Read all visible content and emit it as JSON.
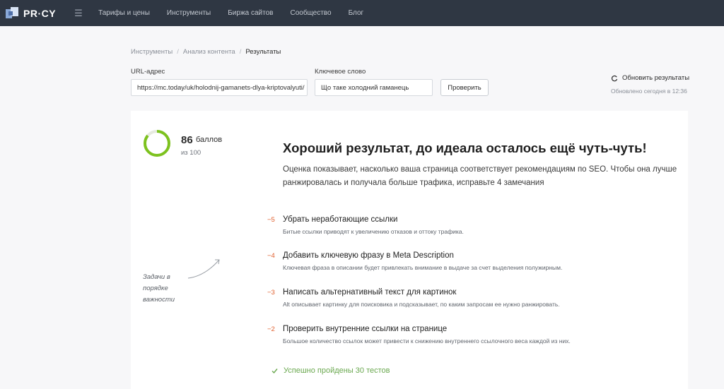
{
  "nav": {
    "logo": "PR·CY",
    "items": [
      "Тарифы и цены",
      "Инструменты",
      "Биржа сайтов",
      "Сообщество",
      "Блог"
    ]
  },
  "breadcrumb": [
    "Инструменты",
    "Анализ контента",
    "Результаты"
  ],
  "form": {
    "url_label": "URL-адрес",
    "url_value": "https://mc.today/uk/holodnij-gamanets-dlya-kriptovalyuti/",
    "keyword_label": "Ключевое слово",
    "keyword_value": "Що таке холодний гаманець",
    "check_button": "Проверить",
    "refresh_label": "Обновить результаты",
    "updated_text": "Обновлено сегодня в 12:36"
  },
  "score": {
    "value": "86",
    "unit": "баллов",
    "of": "из 100",
    "fraction": 0.86,
    "color": "#7dc21e"
  },
  "headline": "Хороший результат, до идеала осталось ещё чуть-чуть!",
  "summary": "Оценка показывает, насколько ваша страница соответствует рекомендациям по SEO. Чтобы она лучше ранжировалась и получала больше трафика, исправьте 4 замечания",
  "note": "Задачи в порядке важности",
  "tasks": [
    {
      "penalty": "−5",
      "title": "Убрать неработающие ссылки",
      "desc": "Битые ссылки приводят к увеличению отказов и оттоку трафика."
    },
    {
      "penalty": "−4",
      "title": "Добавить ключевую фразу в Meta Description",
      "desc": "Ключевая фраза в описании будет привлекать внимание в выдаче за счет выделения полужирным."
    },
    {
      "penalty": "−3",
      "title": "Написать альтернативный текст для картинок",
      "desc": "Alt описывает картинку для поисковика и подсказывает, по каким запросам ее нужно ранжировать."
    },
    {
      "penalty": "−2",
      "title": "Проверить внутренние ссылки на странице",
      "desc": "Большое количество ссылок может привести к снижению внутреннего ссылочного веса каждой из них."
    }
  ],
  "passed": "Успешно пройдены 30 тестов",
  "colors": {
    "nav_bg": "#2f3743",
    "penalty": "#e0602f",
    "success": "#6aa84f",
    "accent": "#7dc21e"
  },
  "icons": {
    "menu": "menu-icon",
    "refresh": "refresh-icon",
    "check": "check-icon"
  }
}
